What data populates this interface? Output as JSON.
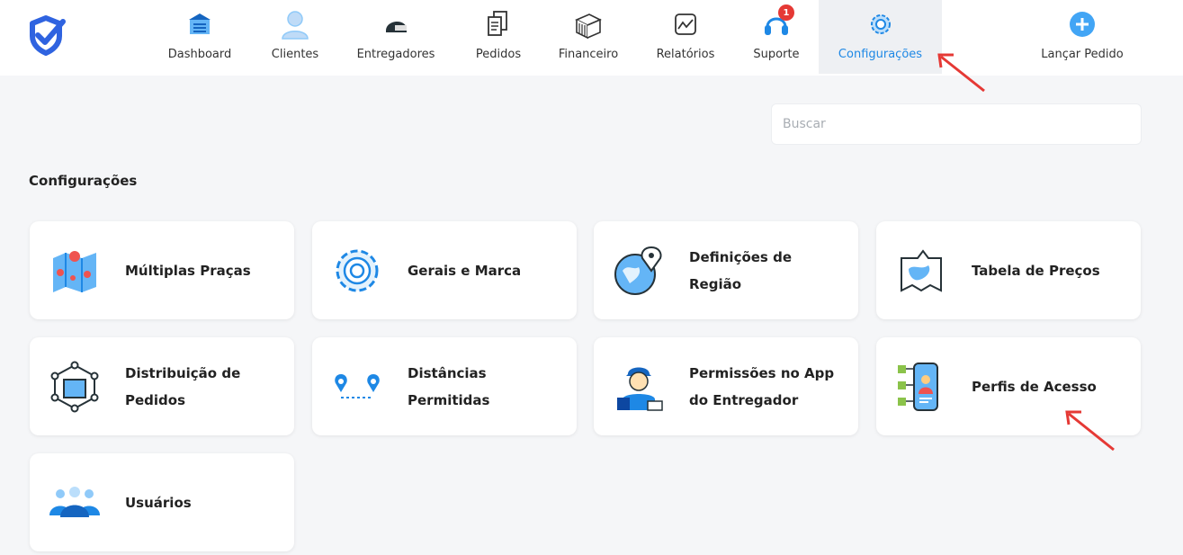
{
  "nav": {
    "items": [
      {
        "label": "Dashboard",
        "icon": "dashboard-icon"
      },
      {
        "label": "Clientes",
        "icon": "user-icon"
      },
      {
        "label": "Entregadores",
        "icon": "helmet-icon"
      },
      {
        "label": "Pedidos",
        "icon": "documents-icon"
      },
      {
        "label": "Financeiro",
        "icon": "money-stack-icon"
      },
      {
        "label": "Relatórios",
        "icon": "chart-icon"
      },
      {
        "label": "Suporte",
        "icon": "headset-icon",
        "badge": "1"
      },
      {
        "label": "Configurações",
        "icon": "gear-icon",
        "active": true
      }
    ],
    "launch_label": "Lançar Pedido"
  },
  "search": {
    "placeholder": "Buscar"
  },
  "section_title": "Configurações",
  "cards": [
    {
      "label": "Múltiplas Praças",
      "icon": "map-pins-icon"
    },
    {
      "label": "Gerais e Marca",
      "icon": "gear-icon"
    },
    {
      "label": "Definições de\nRegião",
      "icon": "globe-pin-icon"
    },
    {
      "label": "Tabela de Preços",
      "icon": "price-map-icon"
    },
    {
      "label": "Distribuição de\nPedidos",
      "icon": "network-box-icon"
    },
    {
      "label": "Distâncias\nPermitidas",
      "icon": "route-pins-icon"
    },
    {
      "label": "Permissões no App\ndo Entregador",
      "icon": "courier-icon"
    },
    {
      "label": "Perfis de Acesso",
      "icon": "profile-checklist-icon"
    },
    {
      "label": "Usuários",
      "icon": "users-group-icon"
    }
  ],
  "colors": {
    "accent": "#1e88e5",
    "badge": "#e53935",
    "arrow": "#e53935"
  }
}
